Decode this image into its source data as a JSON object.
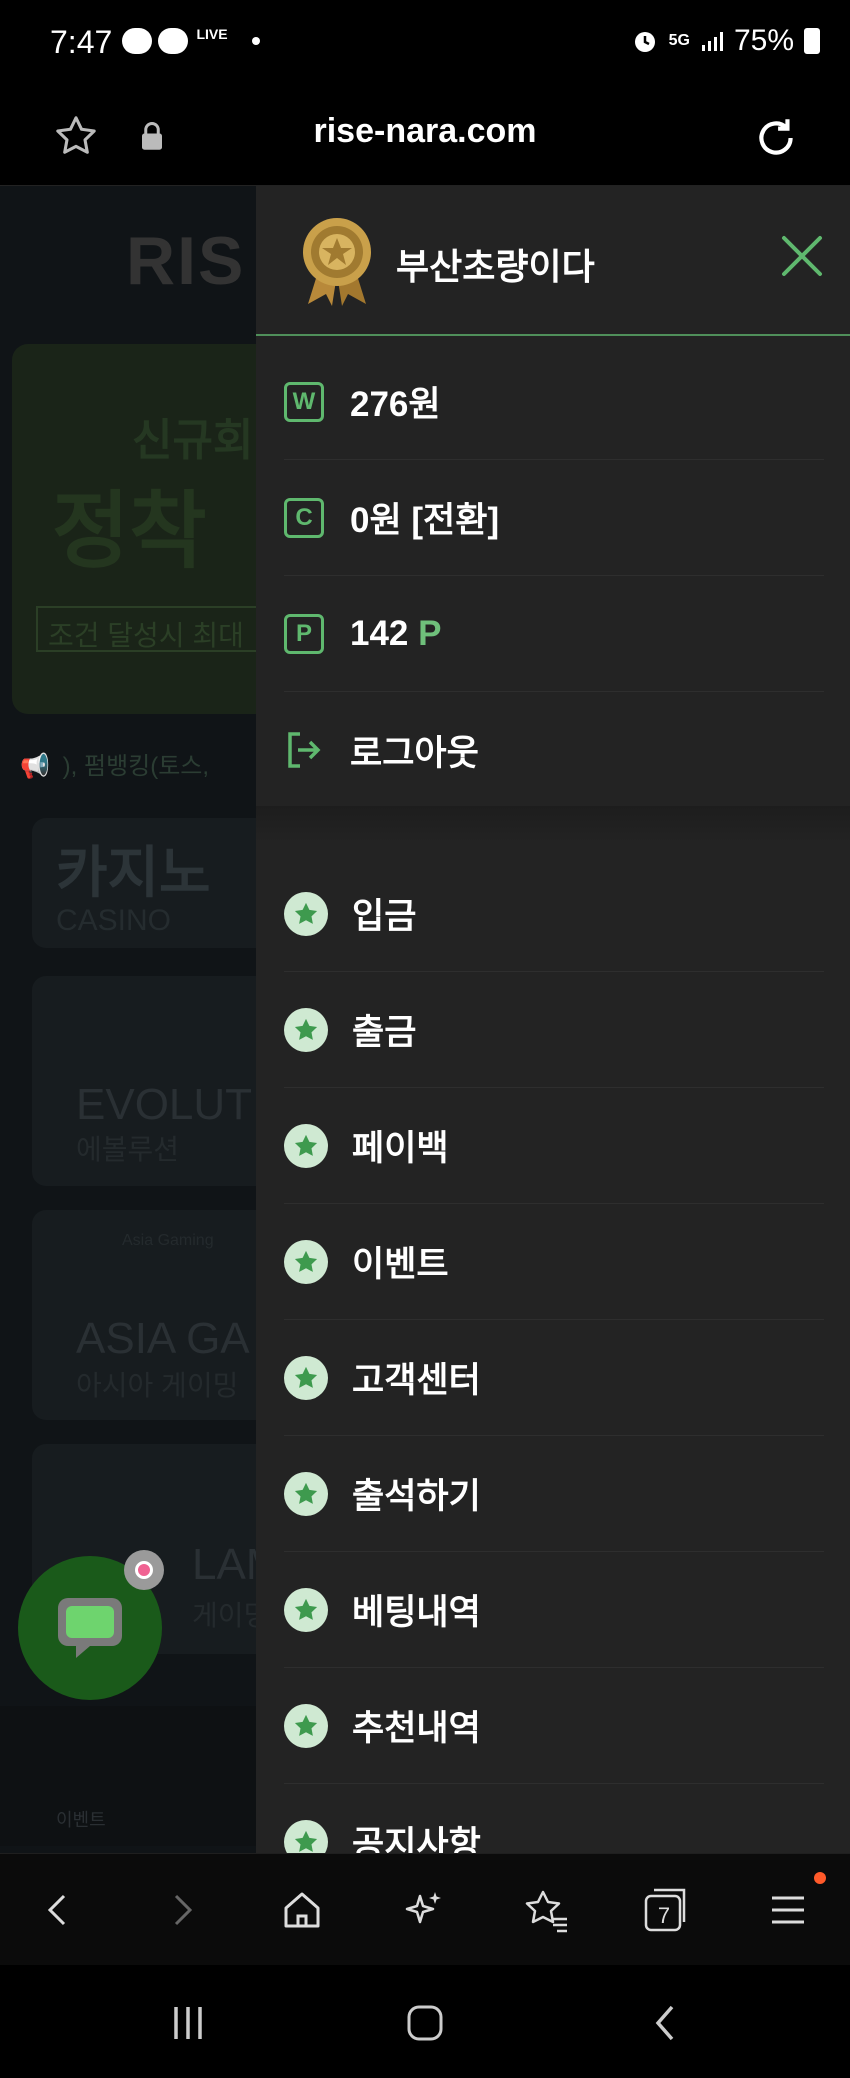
{
  "status_bar": {
    "time": "7:47",
    "live_label": "LIVE",
    "network": "5G",
    "battery": "75%"
  },
  "browser": {
    "url": "rise-nara.com",
    "tab_count": "7"
  },
  "background_site": {
    "logo": "RIS",
    "banner_line1": "신규회",
    "banner_line2": "정착",
    "banner_line3": "조건 달성시 최대",
    "ticker": "), 펌뱅킹(토스,",
    "casino_title": "카지노",
    "casino_sub": "CASINO",
    "card1_title": "EVOLUT",
    "card1_sub": "에볼루션",
    "card2_brand": "Asia Gaming",
    "card2_title": "ASIA GA",
    "card2_sub": "아시아 게이밍",
    "card3_title": "LAM",
    "card3_sub": "게이밍",
    "bottom_nav_label": "이벤트"
  },
  "drawer": {
    "username": "부산초량이다",
    "wallet": {
      "won": {
        "icon": "W",
        "text": "276원"
      },
      "coupon": {
        "icon": "C",
        "text": "0원 [전환]"
      },
      "points": {
        "icon": "P",
        "value": "142",
        "unit": "P"
      },
      "logout": {
        "text": "로그아웃"
      }
    },
    "menu": [
      {
        "label": "입금"
      },
      {
        "label": "출금"
      },
      {
        "label": "페이백"
      },
      {
        "label": "이벤트"
      },
      {
        "label": "고객센터"
      },
      {
        "label": "출석하기"
      },
      {
        "label": "베팅내역"
      },
      {
        "label": "추천내역"
      },
      {
        "label": "공지사항"
      }
    ]
  },
  "colors": {
    "accent_green": "#5fb86e",
    "drawer_bg": "#232323",
    "star_badge_bg": "#cfe9d2"
  },
  "icons": {
    "bookmark": "star-outline-icon",
    "lock": "lock-icon",
    "reload": "reload-icon",
    "close": "close-icon",
    "medal": "medal-icon",
    "logout": "logout-icon",
    "menu_item": "star-badge-icon"
  }
}
